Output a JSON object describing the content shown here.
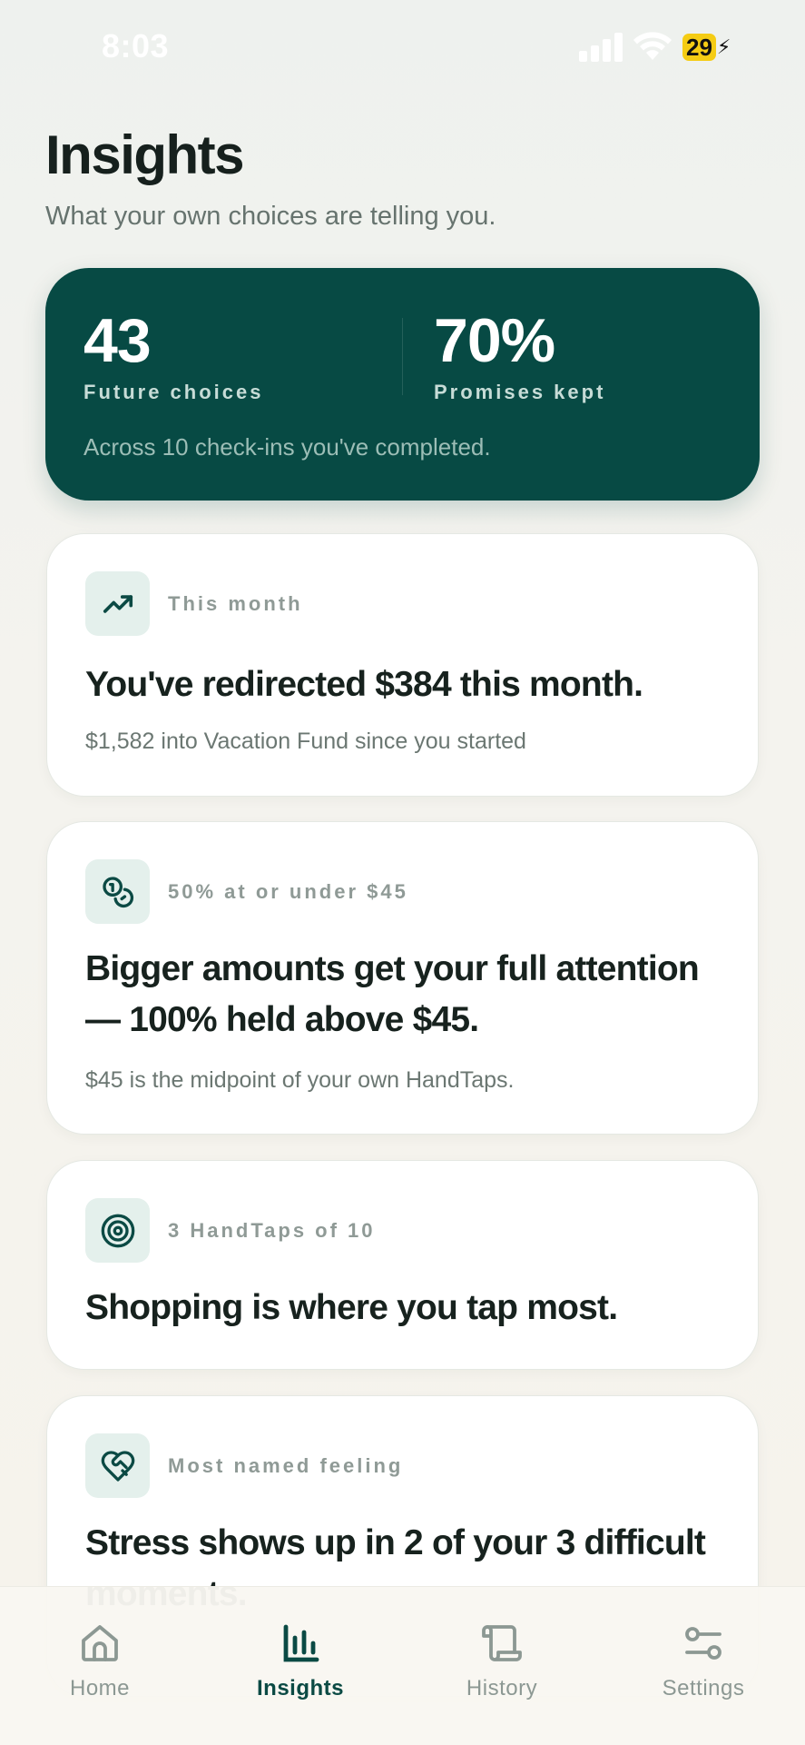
{
  "status_bar": {
    "time": "8:03",
    "battery": "29"
  },
  "header": {
    "title": "Insights",
    "subtitle": "What your own choices are telling you."
  },
  "stats": {
    "future_choices_value": "43",
    "future_choices_label": "Future choices",
    "promises_value": "70%",
    "promises_label": "Promises kept",
    "note": "Across 10 check-ins you've completed."
  },
  "cards": [
    {
      "icon": "trending-up-icon",
      "eyebrow": "This month",
      "headline": "You've redirected $384 this month.",
      "detail": "$1,582 into Vacation Fund since you started"
    },
    {
      "icon": "coins-icon",
      "eyebrow": "50% at or under $45",
      "headline": "Bigger amounts get your full attention — 100% held above $45.",
      "detail": "$45 is the midpoint of your own HandTaps."
    },
    {
      "icon": "target-icon",
      "eyebrow": "3 HandTaps of 10",
      "headline": "Shopping is where you tap most.",
      "detail": ""
    },
    {
      "icon": "heart-handshake-icon",
      "eyebrow": "Most named feeling",
      "headline": "Stress shows up in 2 of your 3 difficult moments.",
      "detail": ""
    }
  ],
  "tabs": [
    {
      "label": "Home",
      "icon": "home-icon",
      "active": false
    },
    {
      "label": "Insights",
      "icon": "bar-chart-icon",
      "active": true
    },
    {
      "label": "History",
      "icon": "scroll-icon",
      "active": false
    },
    {
      "label": "Settings",
      "icon": "sliders-icon",
      "active": false
    }
  ],
  "colors": {
    "accent": "#074a44",
    "icon_tint": "#0b4a44",
    "icon_bg": "#e4f0ec",
    "battery": "#f5cc14"
  }
}
